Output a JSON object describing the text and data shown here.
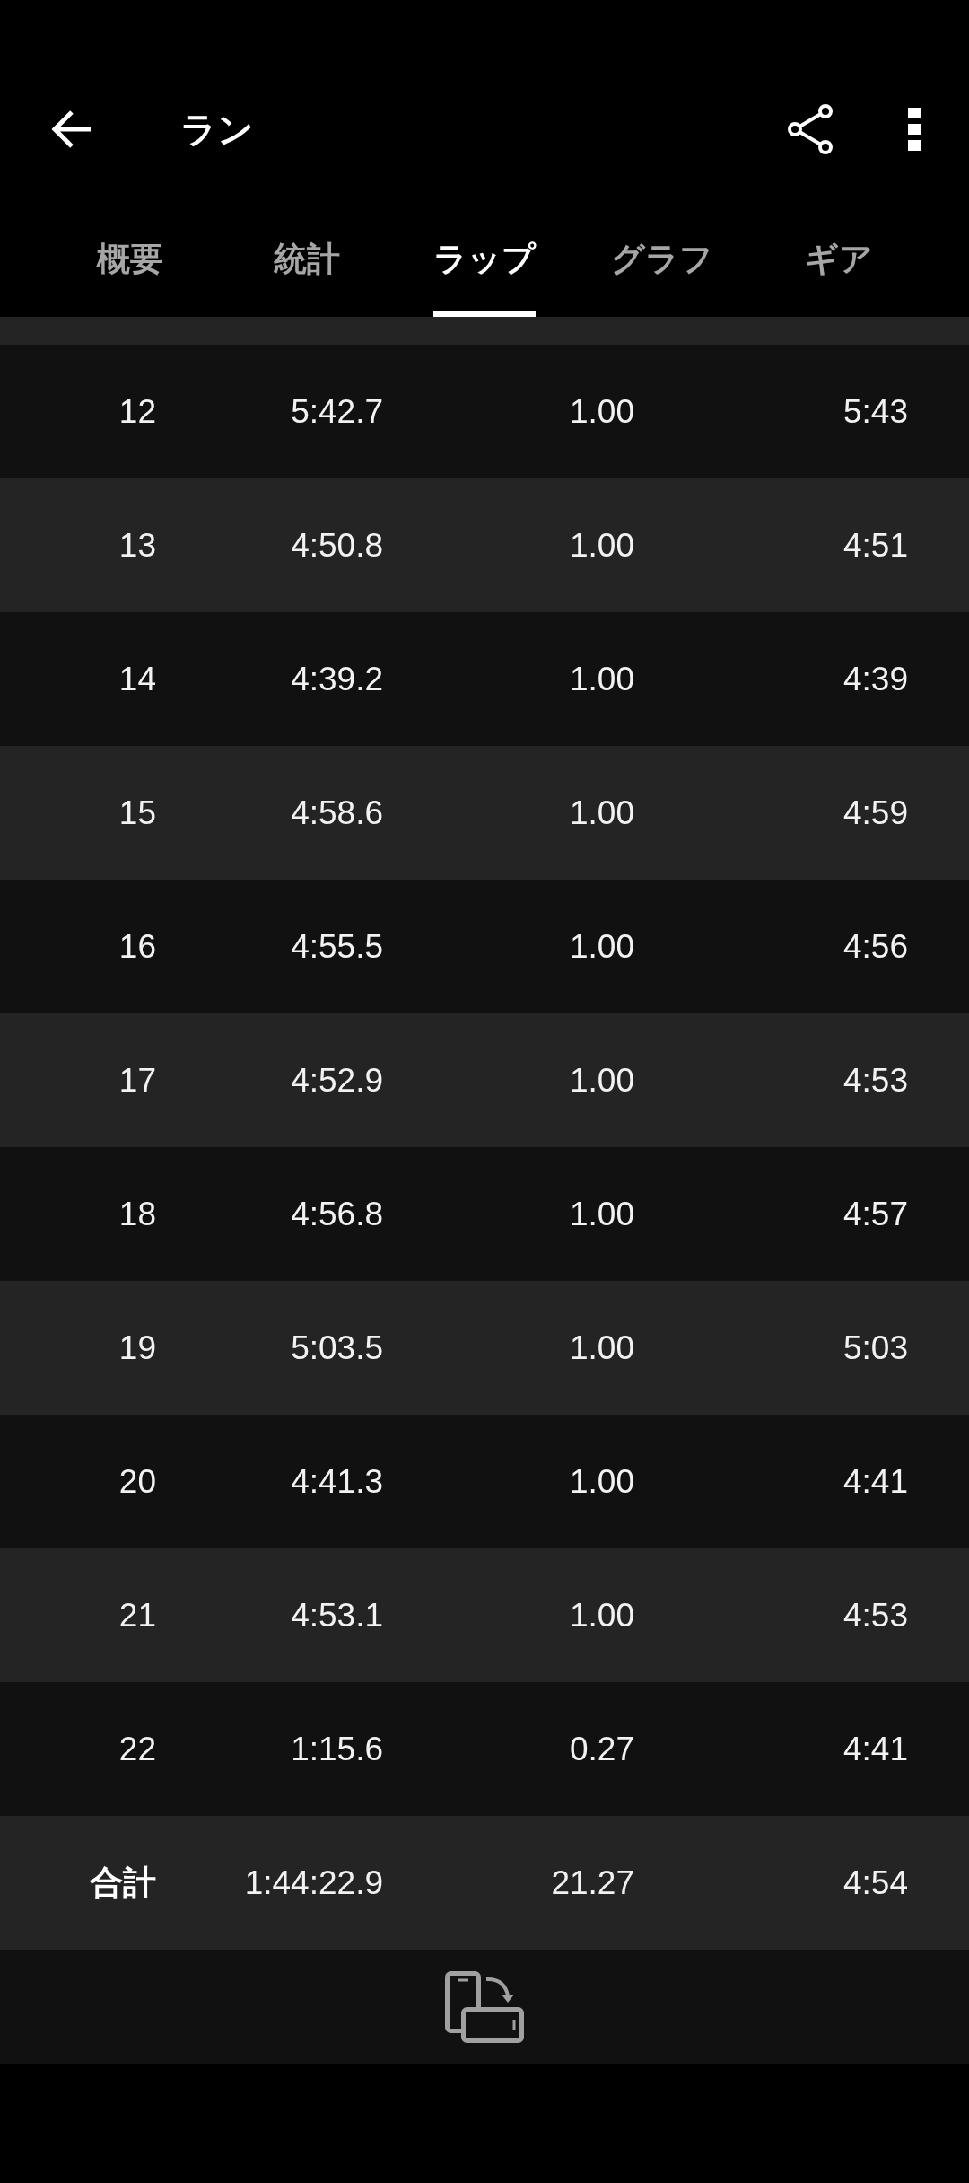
{
  "app_bar": {
    "title": "ラン"
  },
  "tabs": [
    {
      "label": "概要",
      "selected": false
    },
    {
      "label": "統計",
      "selected": false
    },
    {
      "label": "ラップ",
      "selected": true
    },
    {
      "label": "グラフ",
      "selected": false
    },
    {
      "label": "ギア",
      "selected": false
    }
  ],
  "lap_table": {
    "rows": [
      {
        "cells": [
          "12",
          "5:42.7",
          "1.00",
          "5:43"
        ]
      },
      {
        "cells": [
          "13",
          "4:50.8",
          "1.00",
          "4:51"
        ]
      },
      {
        "cells": [
          "14",
          "4:39.2",
          "1.00",
          "4:39"
        ]
      },
      {
        "cells": [
          "15",
          "4:58.6",
          "1.00",
          "4:59"
        ]
      },
      {
        "cells": [
          "16",
          "4:55.5",
          "1.00",
          "4:56"
        ]
      },
      {
        "cells": [
          "17",
          "4:52.9",
          "1.00",
          "4:53"
        ]
      },
      {
        "cells": [
          "18",
          "4:56.8",
          "1.00",
          "4:57"
        ]
      },
      {
        "cells": [
          "19",
          "5:03.5",
          "1.00",
          "5:03"
        ]
      },
      {
        "cells": [
          "20",
          "4:41.3",
          "1.00",
          "4:41"
        ]
      },
      {
        "cells": [
          "21",
          "4:53.1",
          "1.00",
          "4:53"
        ]
      },
      {
        "cells": [
          "22",
          "1:15.6",
          "0.27",
          "4:41"
        ]
      }
    ],
    "total": {
      "label": "合計",
      "cells": [
        "1:44:22.9",
        "21.27",
        "4:54"
      ]
    }
  }
}
